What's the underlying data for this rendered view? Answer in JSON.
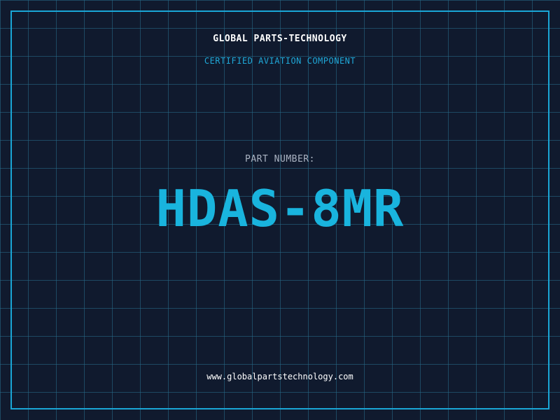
{
  "header": {
    "company": "GLOBAL PARTS-TECHNOLOGY",
    "subtitle": "CERTIFIED AVIATION COMPONENT"
  },
  "part": {
    "label": "PART NUMBER:",
    "number": "HDAS-8MR"
  },
  "footer": {
    "website": "www.globalpartstechnology.com"
  },
  "colors": {
    "background": "#101a2e",
    "grid": "#286e8c",
    "frame": "#1aa6d6",
    "accent": "#19b4de",
    "label": "#aab3c2"
  }
}
